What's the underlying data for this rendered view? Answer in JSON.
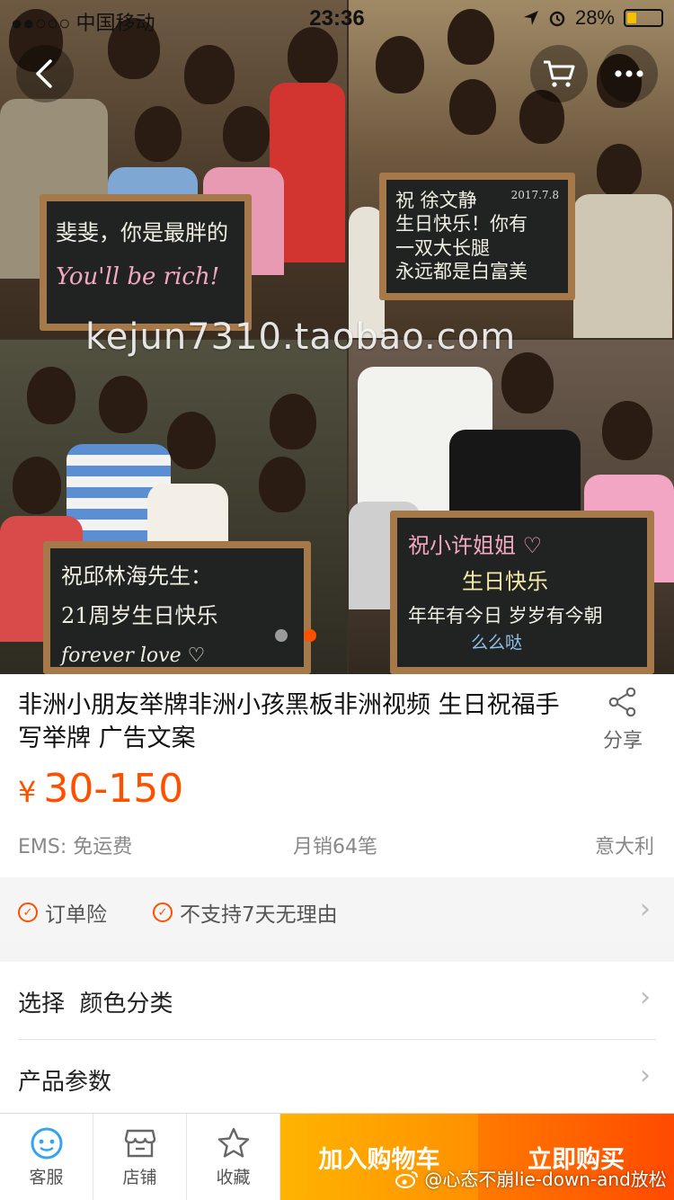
{
  "status_bar": {
    "carrier": "●●○○○ 中国移动",
    "time": "23:36",
    "battery_percent": "28%",
    "battery_level": 0.28
  },
  "hero": {
    "boards": {
      "top_left": [
        "斐斐，你是最胖的",
        "You'll be rich!"
      ],
      "top_right": [
        "祝 徐文静",
        "生日快乐！你有",
        "一双大长腿",
        "永远都是白富美"
      ],
      "top_right_date": "2017.7.8",
      "bottom_left": [
        "祝邱林海先生：",
        "21周岁生日快乐",
        "forever love ♡"
      ],
      "bottom_right": [
        "祝小许姐姐 ♡",
        "生日快乐",
        "年年有今日 岁岁有今朝",
        "么么哒"
      ]
    },
    "watermark": "kejun7310.taobao.com",
    "carousel": {
      "count": 2,
      "active_index": 1
    }
  },
  "product": {
    "title": "非洲小朋友举牌非洲小孩黑板非洲视频 生日祝福手写举牌 广告文案",
    "share_label": "分享",
    "currency": "¥",
    "price": "30-150",
    "shipping": "EMS: 免运费",
    "monthly_sales": "月销64笔",
    "location": "意大利"
  },
  "guarantees": [
    "订单险",
    "不支持7天无理由"
  ],
  "options": {
    "select_label": "选择  颜色分类",
    "params_label": "产品参数"
  },
  "bottom_bar": {
    "service": "客服",
    "shop": "店铺",
    "favorite": "收藏",
    "add_to_cart": "加入购物车",
    "buy_now": "立即购买"
  },
  "watermark_weibo": "@心态不崩lie-down-and放松",
  "colors": {
    "accent": "#ff5000",
    "cart_btn": "#ff9f00",
    "buy_btn": "#ff5500"
  },
  "icons": [
    "back-icon",
    "cart-icon",
    "more-icon",
    "share-icon",
    "check-circle-icon",
    "chevron-right-icon",
    "service-icon",
    "shop-icon",
    "star-icon",
    "weibo-icon"
  ]
}
